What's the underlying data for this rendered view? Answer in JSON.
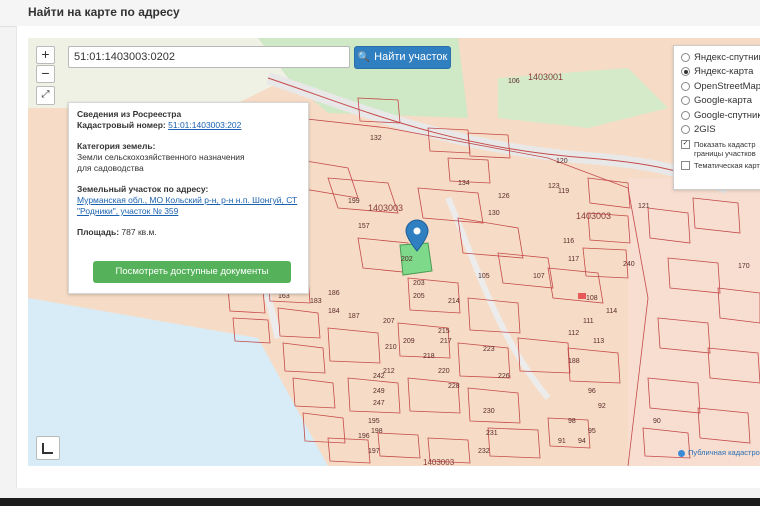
{
  "header": {
    "title": "Найти на карте по адресу"
  },
  "search": {
    "value": "51:01:1403003:0202",
    "button_label": "Найти участок"
  },
  "zoom": {
    "in_label": "+",
    "out_label": "−"
  },
  "info_card": {
    "title": "Сведения из Росреестра",
    "cadastral_label": "Кадастровый номер:",
    "cadastral_value": "51:01:1403003:202",
    "category_label": "Категория земель:",
    "category_value_1": "Земли сельскохозяйственного назначения",
    "category_value_2": "для садоводства",
    "address_label": "Земельный участок по адресу:",
    "address_value_1": "Мурманская обл., МО Кольский р-н, р-н н.п. Шонгуй, СТ",
    "address_value_2": "\"Родники\", участок № 359",
    "area_label": "Площадь:",
    "area_value": "787 кв.м.",
    "docs_button": "Посмотреть доступные документы"
  },
  "layers": {
    "options": [
      {
        "label": "Яндекс-спутник",
        "selected": false
      },
      {
        "label": "Яндекс-карта",
        "selected": true
      },
      {
        "label": "OpenStreetMap",
        "selected": false
      },
      {
        "label": "Google-карта",
        "selected": false
      },
      {
        "label": "Google-спутник",
        "selected": false
      },
      {
        "label": "2GIS",
        "selected": false
      }
    ],
    "cadastre_toggle_1": "Показать кадастр",
    "cadastre_toggle_2": "границы участков",
    "thematic_toggle": "Тематическая карта"
  },
  "map_labels": {
    "quarter_top": "1403001",
    "quarter_mid": "1403003",
    "quarter_right": "1403003",
    "quarter_bottom": "1403003",
    "plots": [
      "106",
      "132",
      "134",
      "130",
      "126",
      "123",
      "120",
      "119",
      "116",
      "117",
      "121",
      "105",
      "107",
      "108",
      "111",
      "112",
      "113",
      "114",
      "170",
      "202",
      "203",
      "205",
      "207",
      "209",
      "210",
      "212",
      "214",
      "215",
      "217",
      "218",
      "220",
      "223",
      "226",
      "228",
      "230",
      "231",
      "232",
      "240",
      "242",
      "247",
      "249",
      "195",
      "196",
      "197",
      "198",
      "199",
      "157",
      "159",
      "163",
      "183",
      "184",
      "186",
      "187",
      "188",
      "96",
      "98",
      "92",
      "91",
      "94",
      "95",
      "90",
      "89"
    ]
  },
  "attribution": {
    "text": "Публичная кадастровая карта"
  },
  "colors": {
    "accent": "#2f7fc1",
    "button_green": "#55b25a",
    "parcel_line": "#c44a4a",
    "selected_parcel": "#7ed98a",
    "marker": "#2f7fc1"
  }
}
